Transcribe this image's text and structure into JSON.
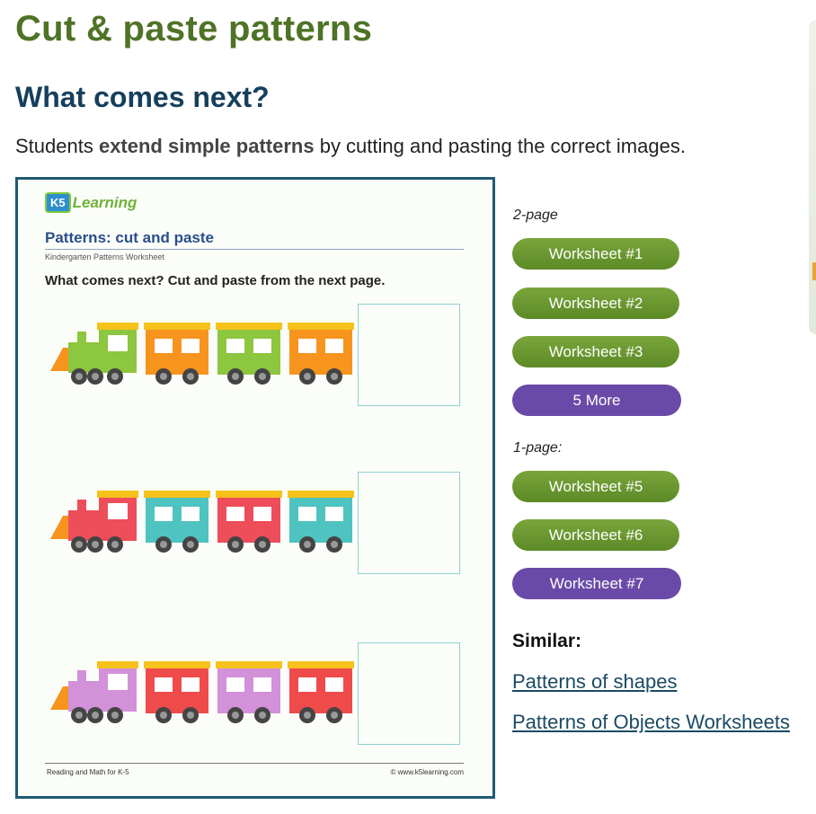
{
  "page": {
    "title": "Cut & paste patterns",
    "subtitle": "What comes next?",
    "intro_pre": "Students ",
    "intro_bold": "extend simple patterns",
    "intro_post": " by cutting and pasting the correct images."
  },
  "worksheet_preview": {
    "logo_badge": "K5",
    "logo_text": "Learning",
    "title": "Patterns: cut and paste",
    "subtitle": "Kindergarten Patterns Worksheet",
    "instruction": "What comes next? Cut and paste from the next page.",
    "footer_left": "Reading and Math for K-5",
    "footer_right": "© www.k5learning.com",
    "rows": [
      {
        "engine": "#8dc63f",
        "cars": [
          "#f7941d",
          "#8dc63f",
          "#f7941d"
        ]
      },
      {
        "engine": "#ee4d5a",
        "cars": [
          "#4fc3c0",
          "#ee4d5a",
          "#4fc3c0"
        ]
      },
      {
        "engine": "#d291d8",
        "cars": [
          "#ef4b4b",
          "#d291d8",
          "#ef4b4b"
        ]
      }
    ]
  },
  "downloads": {
    "two_page_label": "2-page",
    "one_page_label": "1-page:",
    "two_page_buttons": [
      "Worksheet #1",
      "Worksheet #2",
      "Worksheet #3"
    ],
    "more_button": "5 More",
    "one_page_buttons": [
      "Worksheet #5",
      "Worksheet #6"
    ],
    "last_button": "Worksheet #7"
  },
  "similar": {
    "heading": "Similar:",
    "links": [
      "Patterns of shapes",
      "Patterns of Objects Worksheets"
    ]
  },
  "colors": {
    "title_green": "#4e7326",
    "subtitle_navy": "#163f5c",
    "button_green": "#6a9a30",
    "button_purple": "#6a4aa8",
    "link_color": "#1a4a63"
  }
}
